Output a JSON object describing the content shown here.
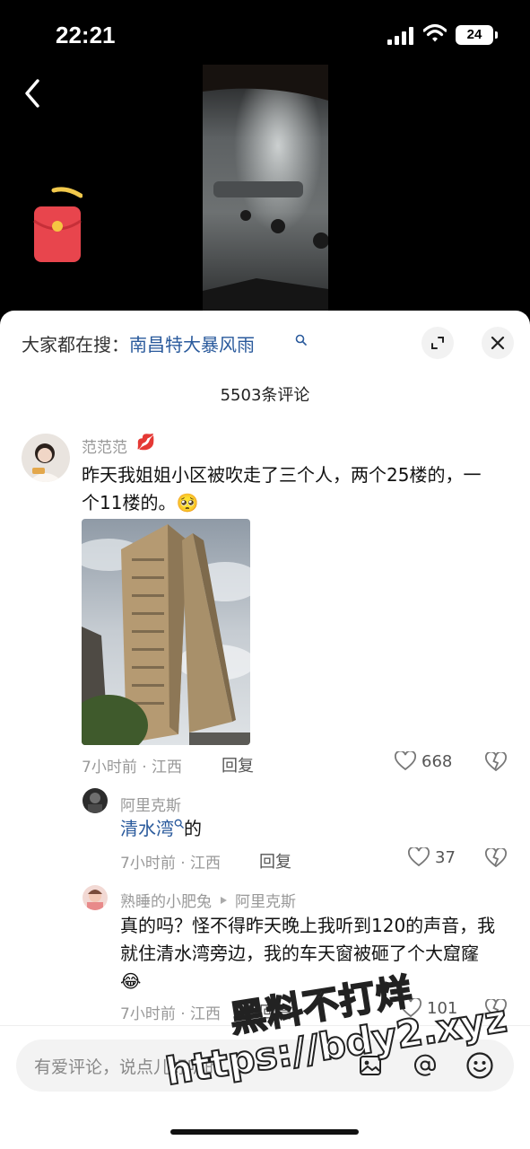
{
  "status_bar": {
    "time": "22:21",
    "battery": "24"
  },
  "search_bar": {
    "prefix": "大家都在搜：",
    "term": "南昌特大暴风雨"
  },
  "comments_header": {
    "count_label": "5503条评论"
  },
  "comments": [
    {
      "username": "范范范",
      "text": "昨天我姐姐小区被吹走了三个人，两个25楼的，一个11楼的。",
      "emoji": "🥺",
      "time_location": "7小时前 · 江西",
      "reply_label": "回复",
      "likes": "668"
    }
  ],
  "replies": [
    {
      "username": "阿里克斯",
      "link_text": "清水湾",
      "text_suffix": "的",
      "time_location": "7小时前 · 江西",
      "reply_label": "回复",
      "likes": "37"
    },
    {
      "username": "熟睡的小肥兔",
      "reply_to": "阿里克斯",
      "text": "真的吗？怪不得昨天晚上我听到120的声音，我就住清水湾旁边，我的车天窗被砸了个大窟窿",
      "emoji": "😂",
      "time_location": "7小时前 · 江西",
      "reply_label": "回复",
      "likes": "101"
    }
  ],
  "input_bar": {
    "placeholder": "有爱评论，说点儿好听的"
  },
  "watermark": {
    "line1": "黑料不打烊",
    "line2": "https://bdy2.xyz"
  },
  "colors": {
    "link": "#2a5a9c",
    "muted": "#999999",
    "sheet_bg": "#ffffff",
    "redpacket": "#e8454d"
  }
}
